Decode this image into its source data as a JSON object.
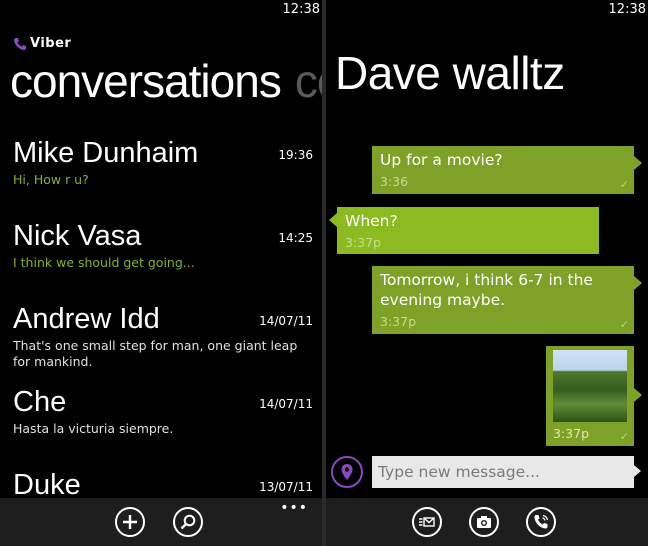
{
  "status_bar": {
    "time": "12:38"
  },
  "left": {
    "brand": "Viber",
    "pivot_title": "conversations",
    "pivot_next": "co",
    "conversations": [
      {
        "name": "Mike Dunhaim",
        "time": "19:36",
        "message": "Hi, How r u?",
        "message_style": "green"
      },
      {
        "name": "Nick Vasa",
        "time": "14:25",
        "message": "I think we should get going...",
        "message_style": "green"
      },
      {
        "name": "Andrew Idd",
        "time": "14/07/11",
        "message": "That's one small step for man, one giant leap for mankind.",
        "message_style": "white"
      },
      {
        "name": "Che",
        "time": "14/07/11",
        "message": "Hasta la victuria siempre.",
        "message_style": "white"
      },
      {
        "name": "Duke",
        "time": "13/07/11",
        "message": "",
        "message_style": "white"
      }
    ],
    "appbar": {
      "add_icon": "add-icon",
      "search_icon": "search-icon",
      "more": "•••"
    }
  },
  "right": {
    "contact_name": "Dave walltz",
    "messages": [
      {
        "direction": "out",
        "text": "Up for a movie?",
        "time": "3:36"
      },
      {
        "direction": "in",
        "text": "When?",
        "time": "3:37p"
      },
      {
        "direction": "out",
        "text": "Tomorrow, i think 6-7 in the evening maybe.",
        "time": "3:37p"
      },
      {
        "direction": "out",
        "text": "",
        "time": "3:37p",
        "image": "landscape-photo"
      }
    ],
    "compose_placeholder": "Type new message...",
    "appbar": {
      "messages_icon": "messages-icon",
      "camera_icon": "camera-icon",
      "call_icon": "phone-call-icon"
    }
  },
  "colors": {
    "accent": "#86b02b",
    "bubble_out": "#7ea228",
    "bubble_in": "#8cba21",
    "viber_purple": "#8c48c4",
    "appbar": "#1e1e1e"
  }
}
